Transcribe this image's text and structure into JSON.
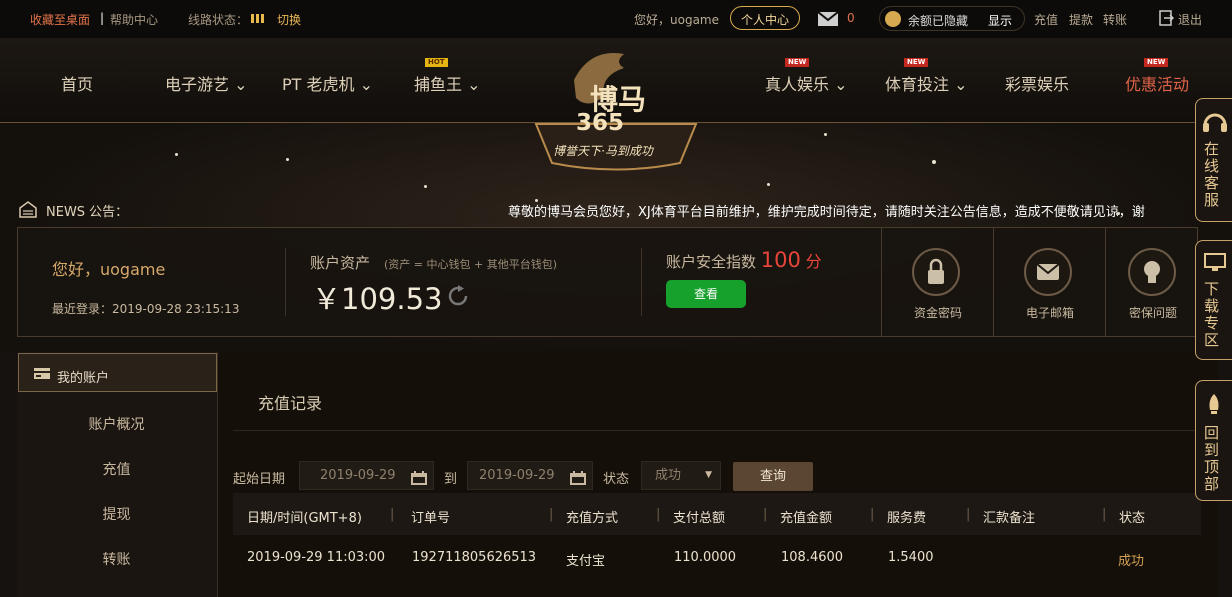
{
  "topbar": {
    "add_to_desktop": "收藏至桌面",
    "sep": "|",
    "help": "帮助中心",
    "line_status_label": "线路状态：",
    "switch": "切换",
    "greeting": "您好，uogame",
    "user_center": "个人中心",
    "mail_count": "0",
    "balance_hidden": "余额已隐藏",
    "show": "显示",
    "deposit": "充值",
    "withdraw": "提款",
    "transfer": "转账",
    "logout": "退出"
  },
  "nav": {
    "home": "首页",
    "egames": "电子游艺",
    "pt": "PT 老虎机",
    "fishing": "捕鱼王",
    "live": "真人娱乐",
    "sports": "体育投注",
    "lottery": "彩票娱乐",
    "promo": "优惠活动",
    "badge_hot": "HOT",
    "badge_new": "NEW"
  },
  "logo": {
    "name": "博马",
    "number": "365",
    "slogan": "博誉天下·马到成功"
  },
  "news": {
    "label": "NEWS 公告：",
    "text": "尊敬的博马会员您好，XJ体育平台目前维护，维护完成时间待定，请随时关注公告信息，造成不便敬请见谅，谢"
  },
  "account": {
    "greeting": "您好，uogame",
    "last_login": "最近登录：2019-09-28 23:15:13",
    "assets_label": "账户资产",
    "assets_note": "(资产 = 中心钱包 + 其他平台钱包)",
    "assets_value": "￥109.53",
    "security_label": "账户安全指数",
    "security_score": "100",
    "security_unit": "分",
    "view_button": "查看",
    "fund_password": "资金密码",
    "email": "电子邮箱",
    "security_question": "密保问题"
  },
  "sidebar": {
    "title": "我的账户",
    "items": [
      "账户概况",
      "充值",
      "提现",
      "转账"
    ]
  },
  "main": {
    "title": "充值记录",
    "filter": {
      "start_label": "起始日期",
      "start_value": "2019-09-29",
      "to_label": "到",
      "end_value": "2019-09-29",
      "status_label": "状态",
      "status_value": "成功",
      "query": "查询"
    },
    "table": {
      "headers": [
        "日期/时间(GMT+8)",
        "订单号",
        "充值方式",
        "支付总额",
        "充值金额",
        "服务费",
        "汇款备注",
        "状态"
      ],
      "rows": [
        [
          "2019-09-29 11:03:00",
          "192711805626513",
          "支付宝",
          "110.0000",
          "108.4600",
          "1.5400",
          "",
          "成功"
        ]
      ]
    }
  },
  "float": {
    "service": "在线客服",
    "download": "下载专区",
    "top": "回到顶部"
  }
}
